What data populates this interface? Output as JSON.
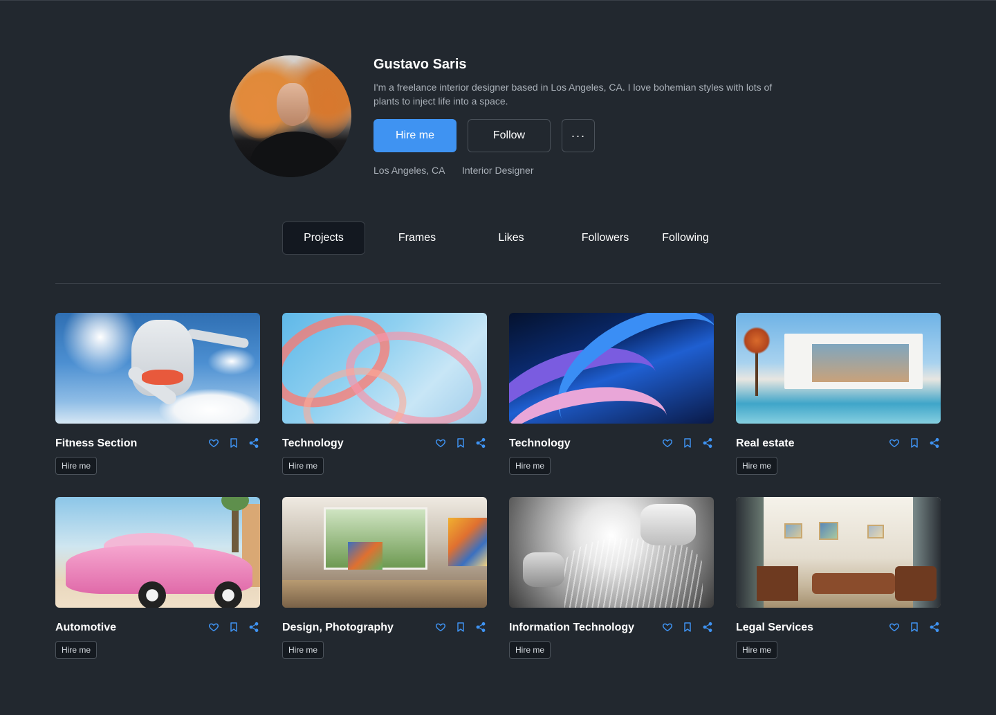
{
  "profile": {
    "name": "Gustavo Saris",
    "bio": "I'm a freelance interior designer based in Los Angeles, CA. I love bohemian styles with lots of plants to inject life into a space.",
    "hire_label": "Hire me",
    "follow_label": "Follow",
    "more_label": "···",
    "location": "Los Angeles, CA",
    "role": "Interior Designer"
  },
  "tabs": [
    {
      "label": "Projects",
      "active": true
    },
    {
      "label": "Frames",
      "active": false
    },
    {
      "label": "Likes",
      "active": false
    },
    {
      "label": "Followers",
      "active": false
    },
    {
      "label": "Following",
      "active": false
    }
  ],
  "colors": {
    "background": "#22282f",
    "accent": "#3f93f2",
    "icon_blue": "#3f93f2",
    "muted_text": "#a9b0b8"
  },
  "card_icons": [
    "heart-icon",
    "bookmark-icon",
    "share-icon"
  ],
  "projects": [
    {
      "title": "Fitness Section",
      "tag": "Hire me"
    },
    {
      "title": "Technology",
      "tag": "Hire me"
    },
    {
      "title": "Technology",
      "tag": "Hire me"
    },
    {
      "title": "Real estate",
      "tag": "Hire me"
    },
    {
      "title": "Automotive",
      "tag": "Hire me"
    },
    {
      "title": "Design, Photography",
      "tag": "Hire me"
    },
    {
      "title": "Information Technology",
      "tag": "Hire me"
    },
    {
      "title": "Legal Services",
      "tag": "Hire me"
    }
  ]
}
